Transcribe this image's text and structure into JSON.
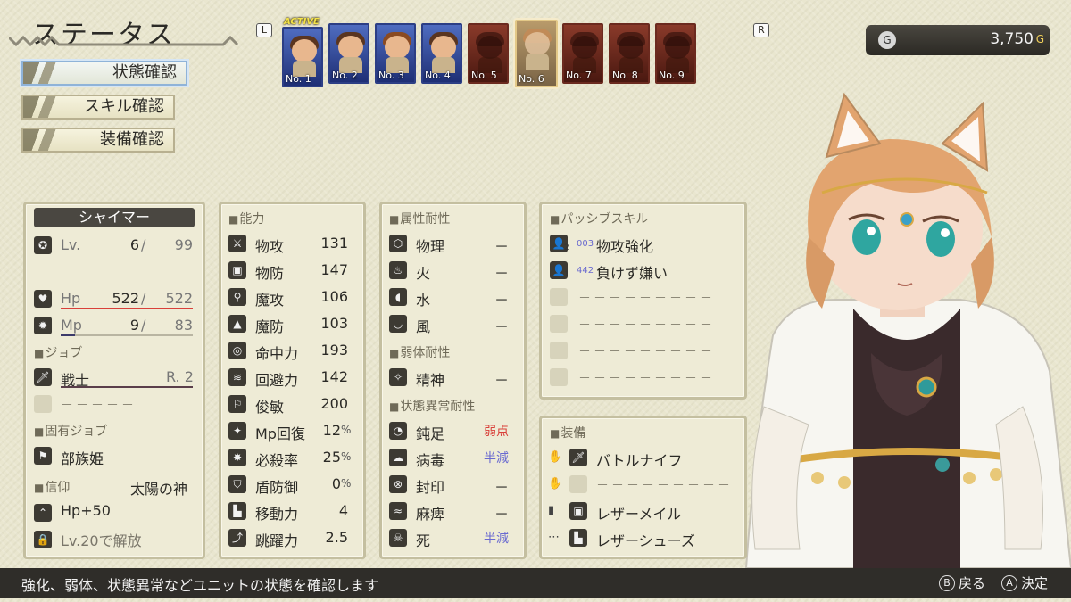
{
  "screen": {
    "title": "ステータス",
    "menu": [
      {
        "label": "状態確認",
        "active": true
      },
      {
        "label": "スキル確認",
        "active": false
      },
      {
        "label": "装備確認",
        "active": false
      }
    ],
    "shoulder_left": "L",
    "shoulder_right": "R"
  },
  "party": {
    "active_tag": "ACTIVE",
    "slots": [
      {
        "num": "No. 1",
        "state": "active"
      },
      {
        "num": "No. 2",
        "state": "available"
      },
      {
        "num": "No. 3",
        "state": "available"
      },
      {
        "num": "No. 4",
        "state": "available"
      },
      {
        "num": "No. 5",
        "state": "locked"
      },
      {
        "num": "No. 6",
        "state": "selected"
      },
      {
        "num": "No. 7",
        "state": "locked"
      },
      {
        "num": "No. 8",
        "state": "locked"
      },
      {
        "num": "No. 9",
        "state": "locked"
      }
    ]
  },
  "gold": {
    "icon": "G",
    "value": "3,750",
    "unit": "G"
  },
  "character": {
    "name": "シャイマー",
    "level_label": "Lv.",
    "level": "6",
    "level_max": "99",
    "hp_label": "Hp",
    "hp": "522",
    "hp_max": "522",
    "hp_ratio": 1.0,
    "mp_label": "Mp",
    "mp": "9",
    "mp_max": "83",
    "mp_ratio": 0.11,
    "sep": "/",
    "job_header": "ジョブ",
    "job": "戦士",
    "job_rank": "R. 2",
    "sub_job_empty": "－－－－－",
    "unique_job_header": "固有ジョブ",
    "unique_job": "部族姫",
    "faith_header": "信仰",
    "faith": "太陽の神",
    "faith_bonus": "Hp+50",
    "faith_unlock": "Lv.20で解放"
  },
  "abilities": {
    "header": "能力",
    "rows": [
      {
        "label": "物攻",
        "value": "131",
        "icon": "crossed-swords-icon"
      },
      {
        "label": "物防",
        "value": "147",
        "icon": "armor-icon"
      },
      {
        "label": "魔攻",
        "value": "106",
        "icon": "staff-icon"
      },
      {
        "label": "魔防",
        "value": "103",
        "icon": "hat-icon"
      },
      {
        "label": "命中力",
        "value": "193",
        "icon": "target-icon"
      },
      {
        "label": "回避力",
        "value": "142",
        "icon": "wind-icon"
      },
      {
        "label": "俊敏",
        "value": "200",
        "icon": "runner-icon"
      },
      {
        "label": "Mp回復",
        "value": "12",
        "unit": "%",
        "icon": "sparkle-icon"
      },
      {
        "label": "必殺率",
        "value": "25",
        "unit": "%",
        "icon": "critical-icon"
      },
      {
        "label": "盾防御",
        "value": "0",
        "unit": "%",
        "icon": "shield-icon"
      },
      {
        "label": "移動力",
        "value": "4",
        "icon": "boot-icon"
      },
      {
        "label": "跳躍力",
        "value": "2.5",
        "icon": "jump-icon"
      }
    ]
  },
  "resistances": {
    "element_header": "属性耐性",
    "elements": [
      {
        "label": "物理",
        "value": "－",
        "icon": "cube-icon"
      },
      {
        "label": "火",
        "value": "－",
        "icon": "fire-icon"
      },
      {
        "label": "水",
        "value": "－",
        "icon": "water-drop-icon"
      },
      {
        "label": "風",
        "value": "－",
        "icon": "wind-bowl-icon"
      }
    ],
    "weak_header": "弱体耐性",
    "weak": [
      {
        "label": "精神",
        "value": "－",
        "icon": "spirit-icon"
      }
    ],
    "status_header": "状態異常耐性",
    "status": [
      {
        "label": "鈍足",
        "value": "弱点",
        "tone": "weak",
        "icon": "slow-icon"
      },
      {
        "label": "病毒",
        "value": "半減",
        "tone": "half",
        "icon": "poison-icon"
      },
      {
        "label": "封印",
        "value": "－",
        "tone": "none",
        "icon": "seal-icon"
      },
      {
        "label": "麻痺",
        "value": "－",
        "tone": "none",
        "icon": "paralysis-icon"
      },
      {
        "label": "死",
        "value": "半減",
        "tone": "half",
        "icon": "skull-icon"
      }
    ],
    "colors": {
      "weak": "#d9403a",
      "half": "#6a6ad0"
    }
  },
  "passive": {
    "header": "パッシブスキル",
    "skills": [
      {
        "code": "003",
        "name": "物攻強化",
        "badge": "2"
      },
      {
        "code": "442",
        "name": "負けず嫌い",
        "badge": "1"
      }
    ],
    "empty": "－－－－－－－－－",
    "empty_count": 4
  },
  "equipment": {
    "header": "装備",
    "items": [
      {
        "name": "バトルナイフ",
        "slot_icon": "right-hand-icon",
        "item_icon": "dagger-icon"
      },
      {
        "name": "－－－－－－－－－",
        "slot_icon": "left-hand-icon",
        "item_icon": "",
        "empty": true
      },
      {
        "name": "レザーメイル",
        "slot_icon": "body-icon",
        "item_icon": "armor-icon"
      },
      {
        "name": "レザーシューズ",
        "slot_icon": "feet-icon",
        "item_icon": "boot-icon"
      }
    ]
  },
  "footer": {
    "help": "強化、弱体、状態異常などユニットの状態を確認します",
    "back_button": "B",
    "back_label": "戻る",
    "confirm_button": "A",
    "confirm_label": "決定"
  }
}
